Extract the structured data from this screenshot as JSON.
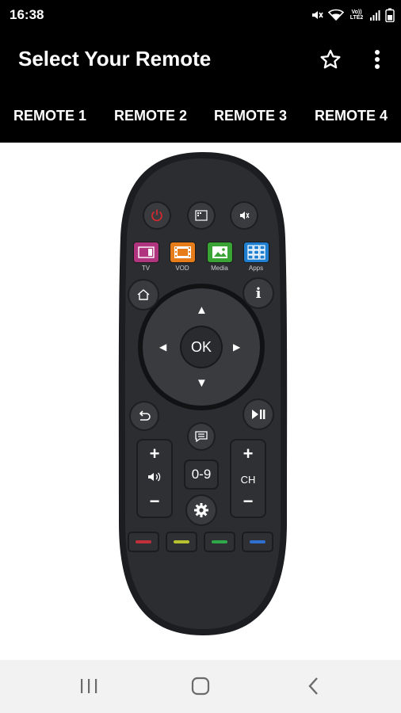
{
  "status_bar": {
    "time": "16:38",
    "network_label_top": "Vo))",
    "network_label_bottom": "LTE2",
    "icons": [
      "mute-icon",
      "wifi-icon",
      "signal-icon",
      "battery-icon"
    ]
  },
  "app_bar": {
    "title": "Select Your Remote",
    "actions": [
      "star-icon",
      "more-vert-icon"
    ]
  },
  "tabs": [
    {
      "label": "REMOTE 1"
    },
    {
      "label": "REMOTE 2"
    },
    {
      "label": "REMOTE 3"
    },
    {
      "label": "REMOTE 4"
    }
  ],
  "remote": {
    "top_row_icons": [
      "power-icon",
      "input-source-icon",
      "mute-icon"
    ],
    "app_buttons": [
      {
        "label": "TV",
        "color": "#b0357e"
      },
      {
        "label": "VOD",
        "color": "#e67c1a"
      },
      {
        "label": "Media",
        "color": "#3aa335"
      },
      {
        "label": "Apps",
        "color": "#1e7ed0"
      }
    ],
    "ok_label": "OK",
    "info_label": "i",
    "numbers_label": "0-9",
    "channel_label": "CH",
    "plus_label": "+",
    "minus_label": "−",
    "color_keys": [
      "#c0303a",
      "#b8c230",
      "#2fa84a",
      "#2f6fd0"
    ],
    "body_color": "#2b2c30"
  },
  "nav_bar": {
    "buttons": [
      "recent-apps-icon",
      "home-icon",
      "back-icon"
    ]
  }
}
